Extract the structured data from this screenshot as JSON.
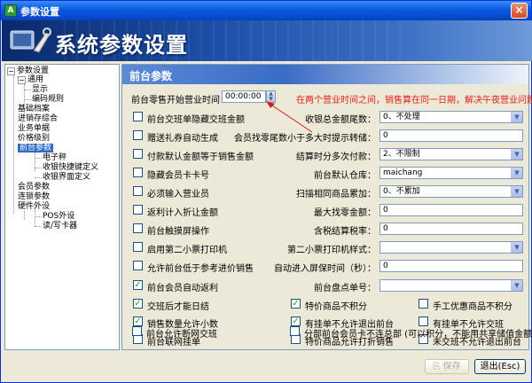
{
  "window": {
    "title": "参数设置",
    "app_icon": "app-icon",
    "close": "×"
  },
  "banner": {
    "title": "系统参数设置"
  },
  "tree": {
    "items": [
      {
        "label": "参数设置",
        "expander": "−"
      },
      {
        "label": "通用",
        "expander": "−"
      },
      {
        "label": "显示"
      },
      {
        "label": "编码规则"
      },
      {
        "label": "基础档案"
      },
      {
        "label": "进销存综合"
      },
      {
        "label": "业务单据"
      },
      {
        "label": "价格级别"
      },
      {
        "label": "前台参数",
        "expander": "−",
        "selected": true
      },
      {
        "label": "电子秤"
      },
      {
        "label": "收银快捷键定义"
      },
      {
        "label": "收银界面定义"
      },
      {
        "label": "会员参数"
      },
      {
        "label": "连锁参数"
      },
      {
        "label": "硬件外设",
        "expander": "−"
      },
      {
        "label": "POS外设"
      },
      {
        "label": "读/写卡器"
      }
    ]
  },
  "panel": {
    "title": "前台参数",
    "start_time_label": "前台零售开始营业时间：",
    "start_time_value": "00:00:00",
    "start_time_hint": "在两个营业时间之间，销售算在同一日期，解决午夜营业问题",
    "left_checks": [
      {
        "label": "前台交班单隐藏交班金额",
        "checked": false
      },
      {
        "label": "赠送礼券自动生成",
        "checked": false
      },
      {
        "label": "付款默认金额等于销售金额",
        "checked": false
      },
      {
        "label": "隐藏会员卡卡号",
        "checked": false
      },
      {
        "label": "必须输入营业员",
        "checked": false
      },
      {
        "label": "返利计入折让金额",
        "checked": false
      },
      {
        "label": "前台触摸屏操作",
        "checked": false
      },
      {
        "label": "启用第二小票打印机",
        "checked": false
      },
      {
        "label": "允许前台低于参考进价销售",
        "checked": false
      },
      {
        "label": "前台会员自动返利",
        "checked": true
      }
    ],
    "right_fields": [
      {
        "label": "收银总金额尾数：",
        "value": "0、不处理",
        "type": "select"
      },
      {
        "label": "会员找零尾数小于多大时提示转储：",
        "value": "0",
        "type": "input"
      },
      {
        "label": "结算时分多次付款：",
        "value": "2、不限制",
        "type": "select"
      },
      {
        "label": "前台默认仓库：",
        "value": "maichang",
        "type": "select"
      },
      {
        "label": "扫描相同商品累加：",
        "value": "0、不累加",
        "type": "select"
      },
      {
        "label": "最大找零金额：",
        "value": "0",
        "type": "input"
      },
      {
        "label": "含税结算税率：",
        "value": "0",
        "type": "input"
      },
      {
        "label": "第二小票打印机样式：",
        "value": "",
        "type": "select"
      },
      {
        "label": "自动进入屏保时间（秒）：",
        "value": "0",
        "type": "input"
      },
      {
        "label": "前台盘点单号：",
        "value": "",
        "type": "select"
      }
    ],
    "grid_checks": [
      {
        "label": "交班后才能日结",
        "checked": true
      },
      {
        "label": "特价商品不积分",
        "checked": true
      },
      {
        "label": "手工优惠商品不积分",
        "checked": false
      },
      {
        "label": "销售数量允许小数",
        "checked": true
      },
      {
        "label": "有挂单不允许退出前台",
        "checked": true
      },
      {
        "label": "有挂单不允许交班",
        "checked": false
      },
      {
        "label": "前台联网挂单",
        "checked": false
      },
      {
        "label": "特价商品允许打折销售",
        "checked": false
      },
      {
        "label": "未交班不允许退出前台",
        "checked": false
      },
      {
        "label": "前台允许断网交班",
        "checked": false
      },
      {
        "label": "分部前台会员卡不连总部 (可以积分，不能用共享储值金额消费)",
        "checked": false
      }
    ]
  },
  "buttons": {
    "save": "保存",
    "exit": "退出(Esc)"
  },
  "colors": {
    "accent": "#316ac5",
    "hint_red": "#e0201a",
    "titlebar": "#0a58e2"
  }
}
